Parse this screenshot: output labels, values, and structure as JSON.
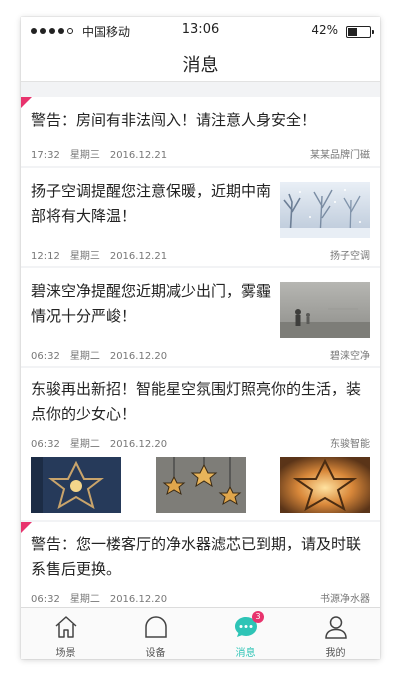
{
  "status_bar": {
    "carrier": "中国移动",
    "time": "13:06",
    "battery": "42%"
  },
  "nav": {
    "title": "消息"
  },
  "messages": [
    {
      "text": "警告：房间有非法闯入！请注意人身安全！",
      "time": "17:32",
      "weekday": "星期三",
      "date": "2016.12.21",
      "source": "某某品牌门磁",
      "alert": true
    },
    {
      "text": "扬子空调提醒您注意保暖，近期中南部将有大降温！",
      "time": "12:12",
      "weekday": "星期三",
      "date": "2016.12.21",
      "source": "扬子空调",
      "image": "snow-scene"
    },
    {
      "text": "碧涞空净提醒您近期减少出门，雾霾情况十分严峻！",
      "time": "06:32",
      "weekday": "星期二",
      "date": "2016.12.20",
      "source": "碧涞空净",
      "image": "smog-scene"
    },
    {
      "text": "东骏再出新招！智能星空氛围灯照亮你的生活，装点你的少女心！",
      "time": "06:32",
      "weekday": "星期二",
      "date": "2016.12.20",
      "source": "东骏智能",
      "images": [
        "star-lamp-blue",
        "star-lamps-hanging",
        "star-lamp-glow"
      ]
    },
    {
      "text": "警告：您一楼客厅的净水器滤芯已到期，请及时联系售后更换。",
      "time": "06:32",
      "weekday": "星期二",
      "date": "2016.12.20",
      "source": "书源净水器",
      "alert": true
    }
  ],
  "tabs": [
    {
      "label": "场景",
      "icon": "home-icon"
    },
    {
      "label": "设备",
      "icon": "device-icon"
    },
    {
      "label": "消息",
      "icon": "chat-icon",
      "badge": "3",
      "active": true
    },
    {
      "label": "我的",
      "icon": "user-icon"
    }
  ],
  "colors": {
    "accent": "#2ec4b6",
    "alert": "#e8336d"
  }
}
